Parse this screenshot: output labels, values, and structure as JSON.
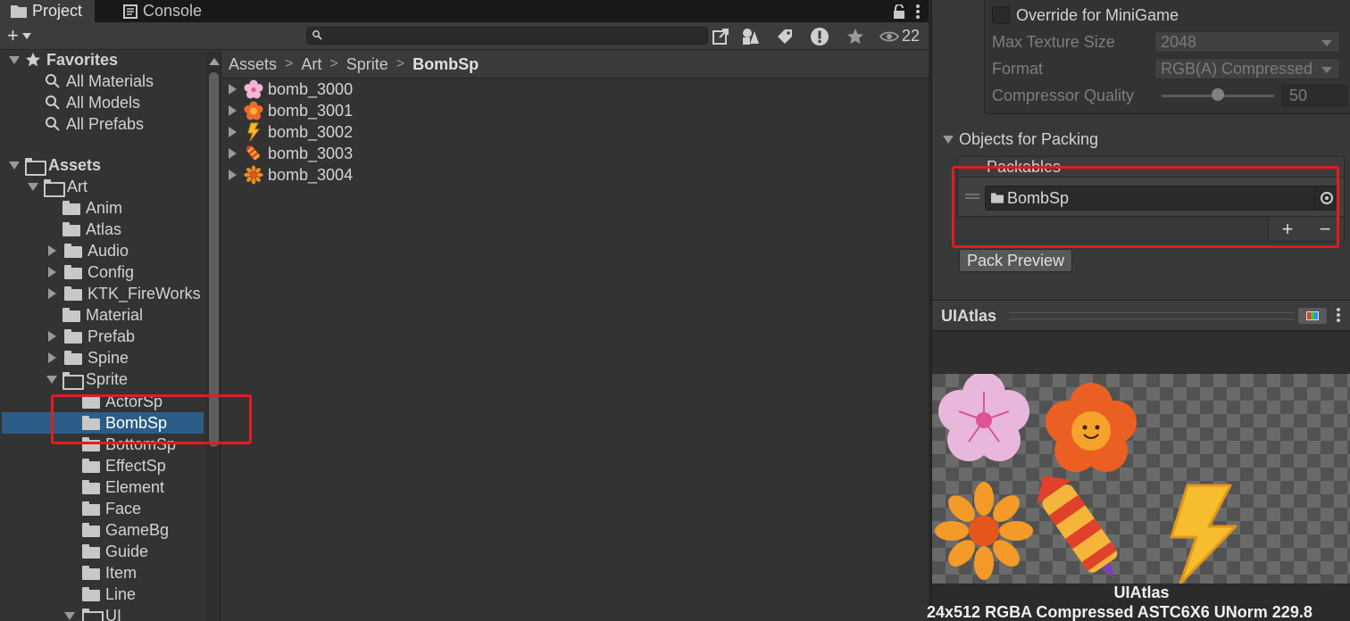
{
  "tabs": [
    {
      "label": "Project",
      "icon": "folder-icon",
      "active": true
    },
    {
      "label": "Console",
      "icon": "console-icon",
      "active": false
    }
  ],
  "toolbar": {
    "add_label": "+",
    "search_value": "",
    "hidden_count": "22"
  },
  "tree": {
    "favorites": {
      "label": "Favorites",
      "items": [
        "All Materials",
        "All Models",
        "All Prefabs"
      ]
    },
    "assets_label": "Assets",
    "art_label": "Art",
    "art_children": [
      {
        "label": "Anim",
        "expandable": false
      },
      {
        "label": "Atlas",
        "expandable": false
      },
      {
        "label": "Audio",
        "expandable": true
      },
      {
        "label": "Config",
        "expandable": true
      },
      {
        "label": "KTK_FireWorks",
        "expandable": true
      },
      {
        "label": "Material",
        "expandable": false
      },
      {
        "label": "Prefab",
        "expandable": true
      },
      {
        "label": "Spine",
        "expandable": true
      }
    ],
    "sprite_label": "Sprite",
    "sprite_children": [
      "ActorSp",
      "BombSp",
      "BottomSp",
      "EffectSp",
      "Element",
      "Face",
      "GameBg",
      "Guide",
      "Item",
      "Line"
    ],
    "selected": "BombSp",
    "ui_label": "UI"
  },
  "breadcrumb": [
    "Assets",
    "Art",
    "Sprite",
    "BombSp"
  ],
  "assets": [
    "bomb_3000",
    "bomb_3001",
    "bomb_3002",
    "bomb_3003",
    "bomb_3004"
  ],
  "inspector": {
    "override_label": "Override for MiniGame",
    "max_texture_label": "Max Texture Size",
    "max_texture_value": "2048",
    "format_label": "Format",
    "format_value": "RGB(A) Compressed",
    "quality_label": "Compressor Quality",
    "quality_value": "50",
    "quality_fraction": 0.5,
    "objects_label": "Objects for Packing",
    "packables_label": "Packables",
    "packable_item": "BombSp",
    "add_label": "+",
    "remove_label": "−",
    "pack_preview_label": "Pack Preview"
  },
  "preview": {
    "title": "UIAtlas",
    "name": "UIAtlas",
    "info": "24x512 RGBA Compressed ASTC6X6 UNorm   229.8"
  },
  "colors": {
    "selection": "#2c5d87",
    "highlight": "#e11d1d"
  }
}
